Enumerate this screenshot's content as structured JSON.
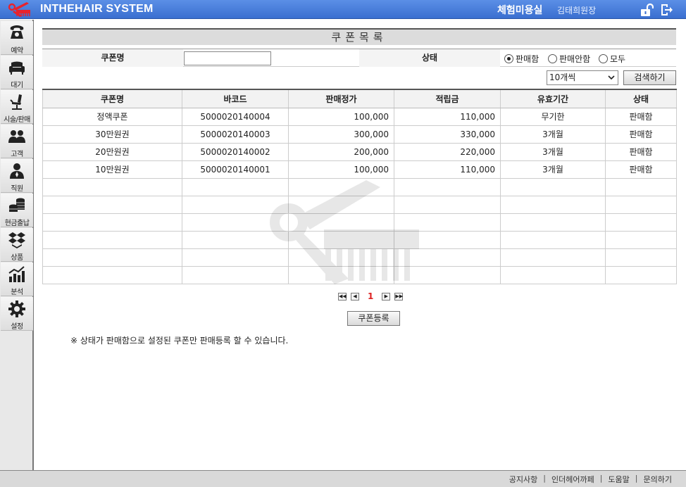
{
  "header": {
    "app_title": "INTHEHAIR SYSTEM",
    "shop_name": "체험미용실",
    "user_name": "김태희원장",
    "colors": {
      "bar": "#3a6fd0",
      "logo": "#e8232d"
    }
  },
  "sidebar": {
    "items": [
      {
        "label": "예약",
        "icon": "phone-icon"
      },
      {
        "label": "대기",
        "icon": "sofa-icon"
      },
      {
        "label": "시술/판매",
        "icon": "salon-chair-icon"
      },
      {
        "label": "고객",
        "icon": "customers-icon"
      },
      {
        "label": "직원",
        "icon": "staff-icon"
      },
      {
        "label": "현금출납",
        "icon": "coins-icon"
      },
      {
        "label": "상품",
        "icon": "box-icon"
      },
      {
        "label": "분석",
        "icon": "chart-icon"
      },
      {
        "label": "설정",
        "icon": "gear-icon"
      }
    ]
  },
  "page": {
    "title": "쿠폰목록",
    "filter": {
      "coupon_label": "쿠폰명",
      "coupon_value": "",
      "status_label": "상태",
      "options": [
        "판매함",
        "판매안함",
        "모두"
      ],
      "selected": "판매함"
    },
    "page_size": "10개씩",
    "search_label": "검색하기",
    "table": {
      "headers": [
        "쿠폰명",
        "바코드",
        "판매정가",
        "적립금",
        "유효기간",
        "상태"
      ],
      "rows": [
        [
          "정액쿠폰",
          "5000020140004",
          "100,000",
          "110,000",
          "무기한",
          "판매함"
        ],
        [
          "30만원권",
          "5000020140003",
          "300,000",
          "330,000",
          "3개월",
          "판매함"
        ],
        [
          "20만원권",
          "5000020140002",
          "200,000",
          "220,000",
          "3개월",
          "판매함"
        ],
        [
          "10만원권",
          "5000020140001",
          "100,000",
          "110,000",
          "3개월",
          "판매함"
        ]
      ],
      "empty_rows": 6
    },
    "pager": {
      "first": "◀◀",
      "prev": "◀",
      "current": "1",
      "next": "▶",
      "last": "▶▶"
    },
    "register_label": "쿠폰등록",
    "note": "※ 상태가 판매함으로 설정된 쿠폰만 판매등록 할 수 있습니다."
  },
  "footer": {
    "links": [
      "공지사항",
      "인더헤어까페",
      "도움말",
      "문의하기"
    ]
  }
}
